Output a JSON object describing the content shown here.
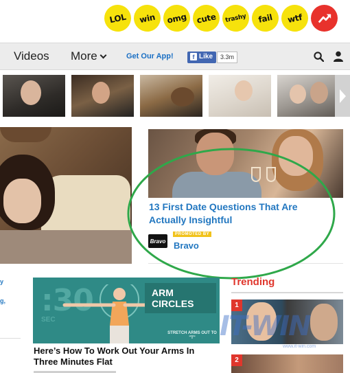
{
  "reactions": [
    {
      "label": "LOL"
    },
    {
      "label": "win"
    },
    {
      "label": "omg"
    },
    {
      "label": "cute"
    },
    {
      "label": "trashy"
    },
    {
      "label": "fail"
    },
    {
      "label": "wtf"
    }
  ],
  "nav": {
    "videos": "Videos",
    "more": "More",
    "get_app": "Get Our App!",
    "fb_like": "Like",
    "fb_count": "3.3m"
  },
  "colors": {
    "reaction_yellow": "#f6e20c",
    "trending_red": "#e0362c",
    "link_blue": "#2277c0",
    "promo_yellow": "#f1c21b",
    "annotation_green": "#2fa84a"
  },
  "featured": {
    "title": "13 First Date Questions That Are Actually Insightful",
    "promoted_label": "PROMOTED BY",
    "sponsor": "Bravo",
    "sponsor_logo_text": "Bravo"
  },
  "left_fragments": [
    "y",
    "",
    "g,"
  ],
  "arm_article": {
    "timer": ":30",
    "timer_unit": "SEC",
    "label": "ARM CIRCLES",
    "caption": "STRETCH ARMS OUT TO \"T\"",
    "title": "Here’s How To Work Out Your Arms In Three Minutes Flat"
  },
  "trending": {
    "heading": "Trending",
    "items": [
      {
        "rank": "1"
      },
      {
        "rank": "2"
      }
    ]
  },
  "watermark": {
    "text": "IT-WIN",
    "sub": "www.it-win.com"
  }
}
